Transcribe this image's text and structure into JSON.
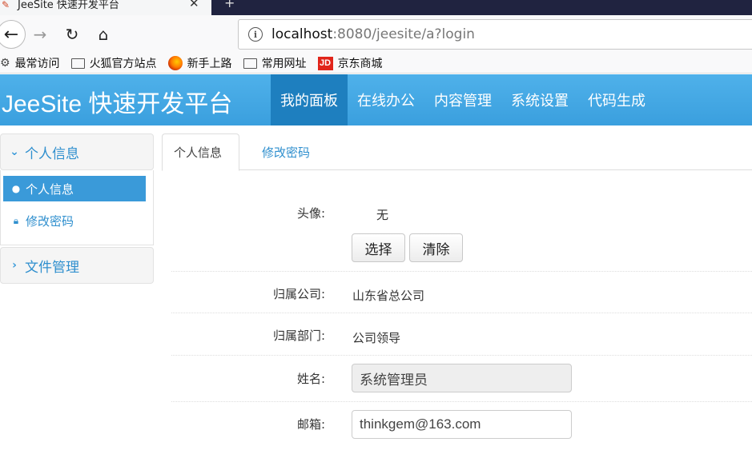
{
  "browser": {
    "tab_title": "JeeSite 快速开发平台",
    "url_host": "localhost",
    "url_path": ":8080/jeesite/a?login",
    "bookmarks": [
      "最常访问",
      "火狐官方站点",
      "新手上路",
      "常用网址",
      "京东商城"
    ],
    "jd_logo_text": "JD"
  },
  "app": {
    "brand": "JeeSite 快速开发平台",
    "nav": [
      "我的面板",
      "在线办公",
      "内容管理",
      "系统设置",
      "代码生成"
    ]
  },
  "sidebar": {
    "group1_title": "个人信息",
    "items": [
      "个人信息",
      "修改密码"
    ],
    "group2_title": "文件管理"
  },
  "content": {
    "tabs": [
      "个人信息",
      "修改密码"
    ],
    "avatar_label": "头像:",
    "avatar_value": "无",
    "select_button": "选择",
    "clear_button": "清除",
    "company_label": "归属公司:",
    "company_value": "山东省总公司",
    "dept_label": "归属部门:",
    "dept_value": "公司领导",
    "name_label": "姓名:",
    "name_value": "系统管理员",
    "email_label": "邮箱:",
    "email_value": "thinkgem@163.com"
  },
  "colors": {
    "header_bg": "#3a9fde",
    "nav_active": "#1e7fbf",
    "accent": "#2f8fce"
  }
}
